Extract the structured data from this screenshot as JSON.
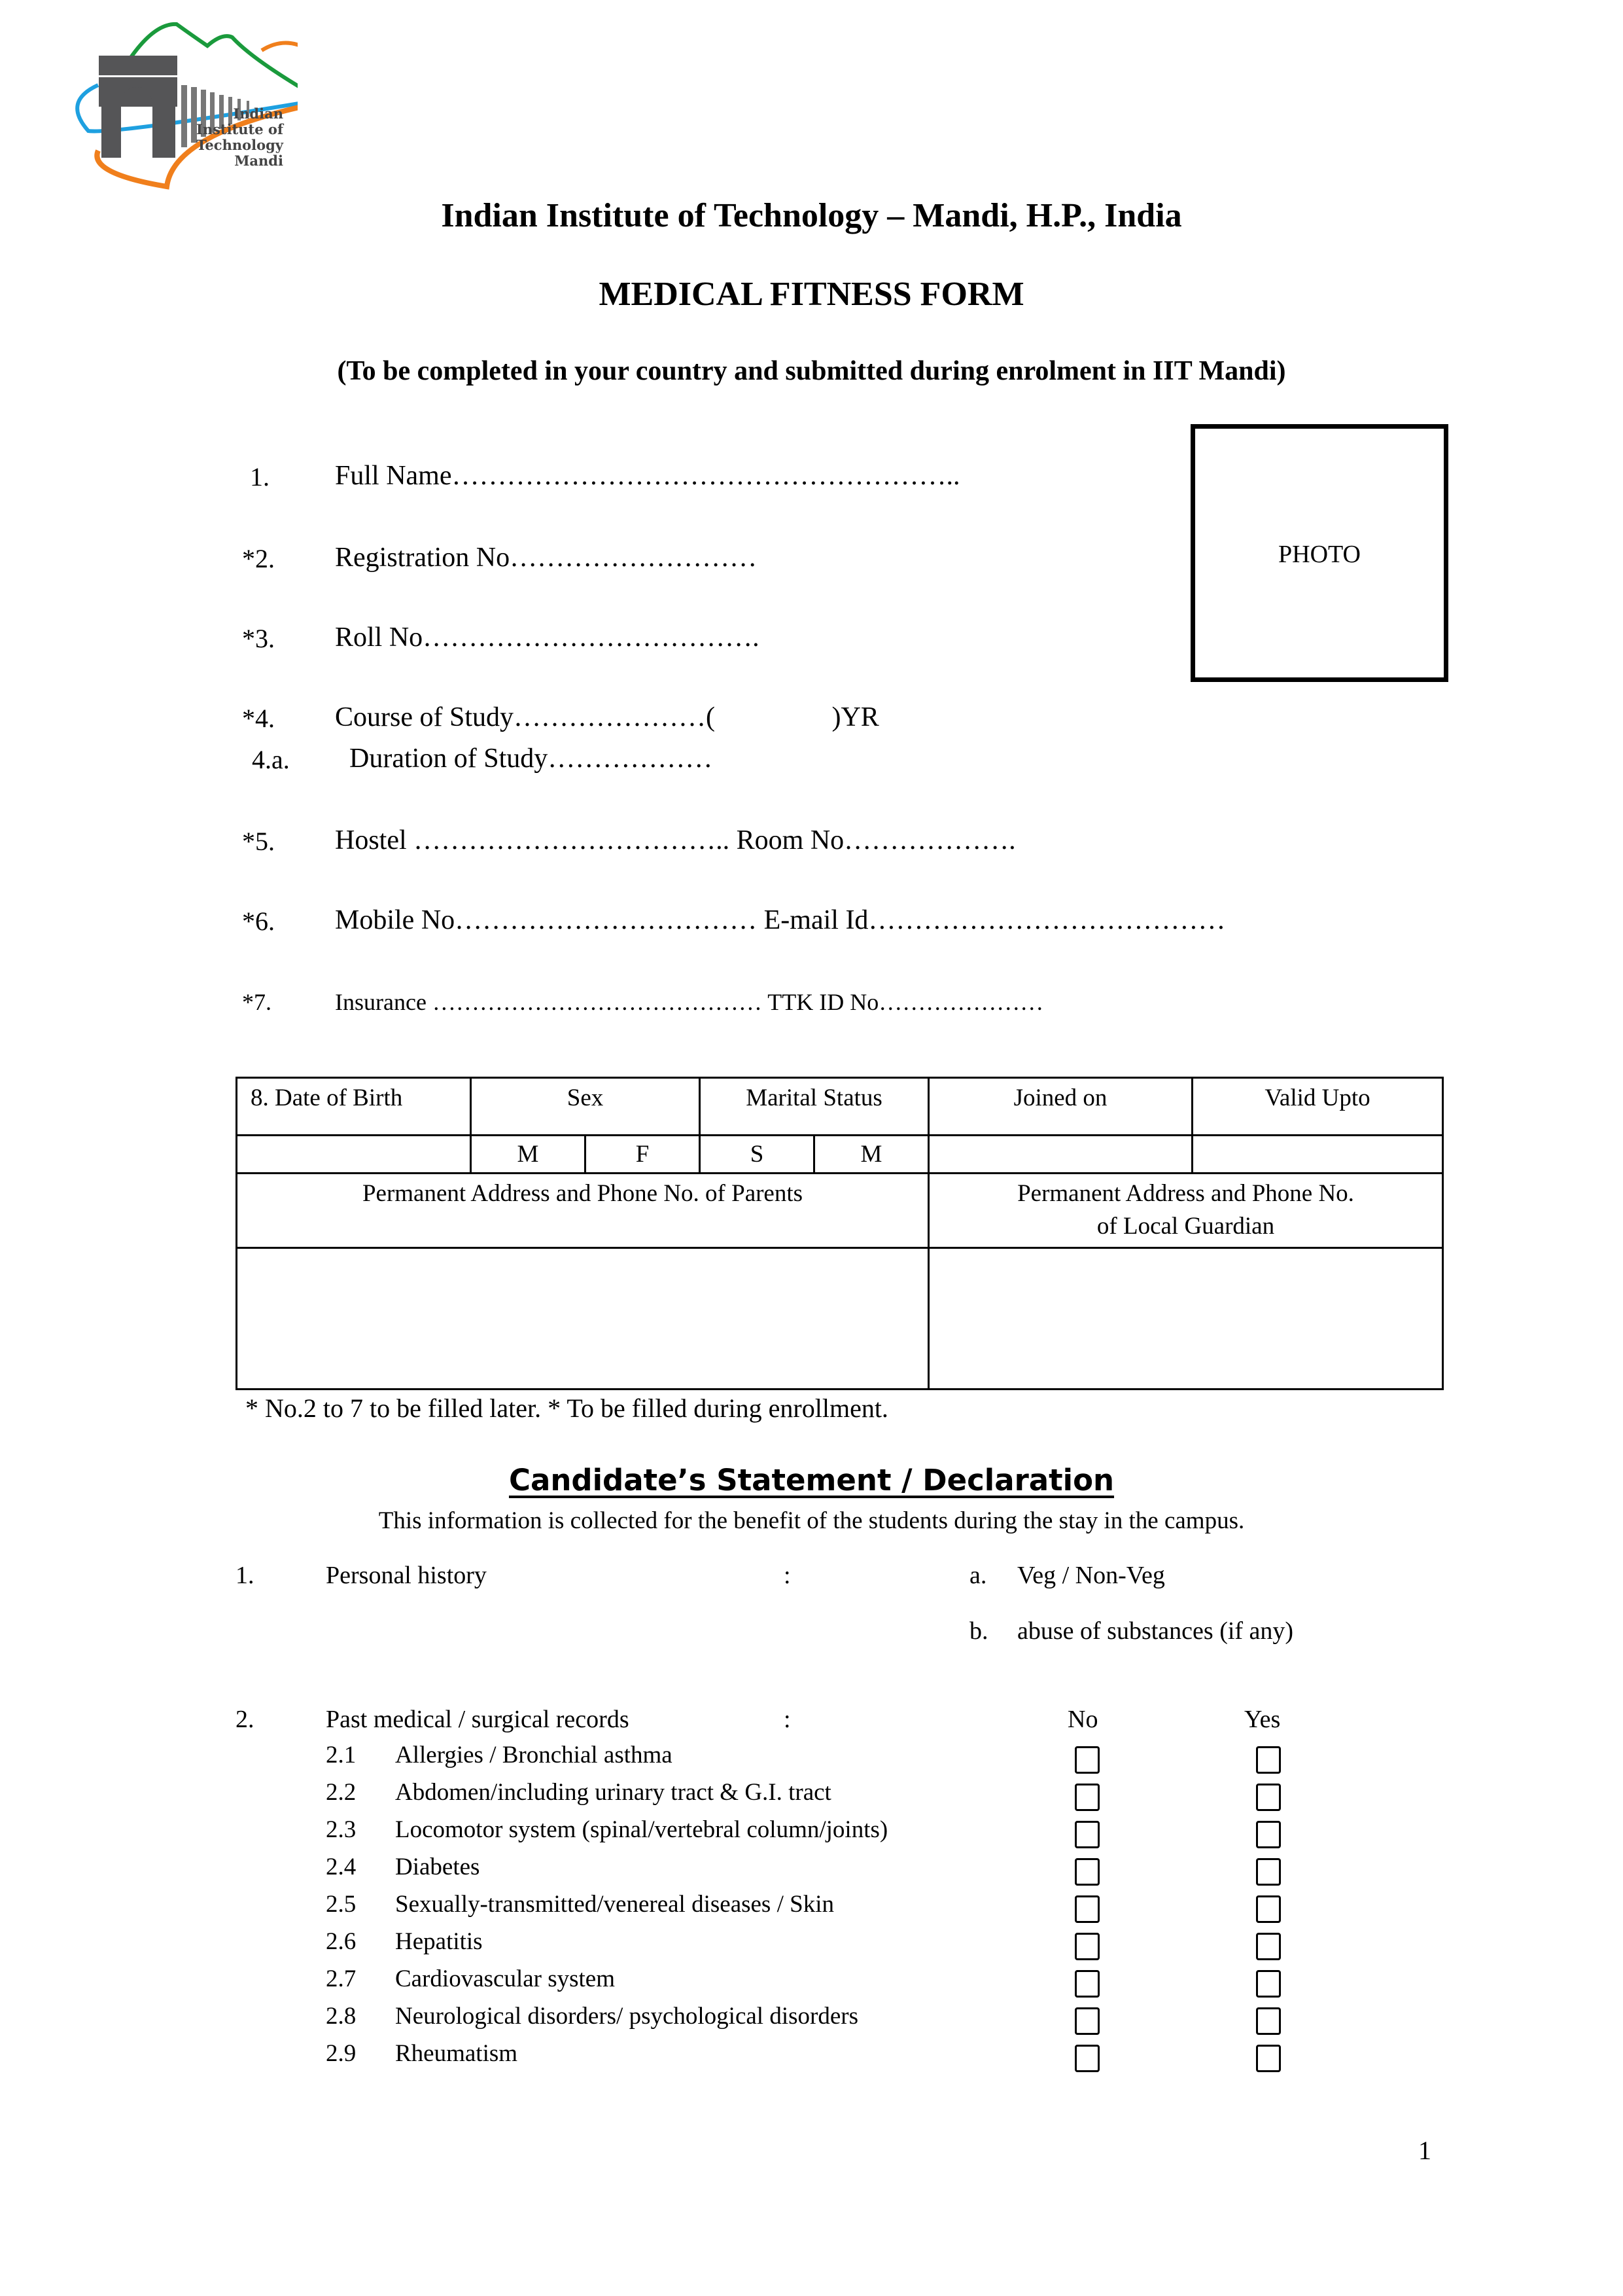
{
  "header": {
    "logo_text": [
      "Indian",
      "Institute of",
      "Technology",
      "Mandi"
    ],
    "institute_title": "Indian Institute of Technology – Mandi, H.P., India",
    "form_title": "MEDICAL FITNESS FORM",
    "subtitle": "(To be completed in your country and submitted during enrolment in IIT Mandi)"
  },
  "photo_label": "PHOTO",
  "fields": [
    {
      "num": "1.",
      "label": "Full Name……………………………………………….."
    },
    {
      "num": "*2.",
      "label": "Registration No………………………"
    },
    {
      "num": "*3.",
      "label": "Roll No………………………………."
    },
    {
      "num": "*4.",
      "label": "Course of Study…………………(                 )YR"
    },
    {
      "num": "4.a.",
      "label": "Duration of Study………………"
    },
    {
      "num": "*5.",
      "label": "Hostel …………………………….. Room No………………."
    },
    {
      "num": "*6.",
      "label": "Mobile No…………………………… E-mail Id…………………………………"
    },
    {
      "num": "*7.",
      "label": "Insurance ……………………………………  TTK ID No…………………"
    }
  ],
  "table": {
    "headers": [
      "8. Date of Birth",
      "Sex",
      "Marital Status",
      "Joined on",
      "Valid Upto"
    ],
    "sex_options": [
      "M",
      "F"
    ],
    "marital_options": [
      "S",
      "M"
    ],
    "address_parents": "Permanent Address and Phone No. of Parents",
    "address_guardian_line1": "Permanent Address and Phone No.",
    "address_guardian_line2": "of Local Guardian"
  },
  "footnote": "* No.2 to 7 to be filled later. * To be filled during enrollment.",
  "declaration": {
    "heading": "Candidate’s Statement / Declaration",
    "info": "This information is collected for the benefit of the students during the stay in the campus.",
    "personal": {
      "num": "1.",
      "label": "Personal history",
      "colon": ":",
      "a_letter": "a.",
      "a_text": "Veg / Non-Veg",
      "b_letter": "b.",
      "b_text": "abuse of substances (if any)"
    },
    "past": {
      "num": "2.",
      "label": "Past medical / surgical records",
      "colon": ":",
      "col_no": "No",
      "col_yes": "Yes",
      "items": [
        {
          "num": "2.1",
          "label": "Allergies / Bronchial asthma",
          "no": false,
          "yes": false
        },
        {
          "num": "2.2",
          "label": "Abdomen/including urinary tract & G.I. tract",
          "no": false,
          "yes": false
        },
        {
          "num": "2.3",
          "label": "Locomotor system (spinal/vertebral column/joints)",
          "no": false,
          "yes": false
        },
        {
          "num": "2.4",
          "label": "Diabetes",
          "no": false,
          "yes": false
        },
        {
          "num": "2.5",
          "label": "Sexually-transmitted/venereal diseases / Skin",
          "no": false,
          "yes": false
        },
        {
          "num": "2.6",
          "label": "Hepatitis",
          "no": false,
          "yes": false
        },
        {
          "num": "2.7",
          "label": "Cardiovascular system",
          "no": false,
          "yes": false
        },
        {
          "num": "2.8",
          "label": "Neurological disorders/ psychological disorders",
          "no": false,
          "yes": false
        },
        {
          "num": "2.9",
          "label": "Rheumatism",
          "no": false,
          "yes": false
        }
      ]
    }
  },
  "page_number": "1",
  "colors": {
    "logo_green": "#1a9a3c",
    "logo_orange": "#f07f1c",
    "logo_blue": "#1ea0e0",
    "logo_gray": "#555557"
  }
}
